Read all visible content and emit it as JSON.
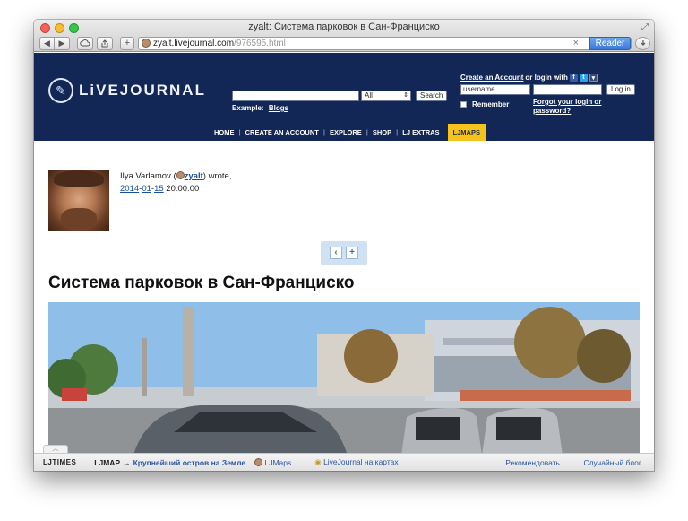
{
  "window": {
    "title": "zyalt: Система парковок в Сан-Франциско"
  },
  "toolbar": {
    "url_host": "zyalt.livejournal.com",
    "url_path": "/976595.html",
    "reader_label": "Reader",
    "clear_icon": "×"
  },
  "header": {
    "logo_text": "LiVEJOURNAL",
    "search": {
      "select_value": "All",
      "button_label": "Search",
      "example_label": "Example:",
      "example_link": "Blogs"
    },
    "login": {
      "create_account": "Create an Account",
      "or_login_with": "or login with",
      "username_value": "username",
      "login_button": "Log in",
      "remember": "Remember",
      "forgot": "Forgot your login or password?"
    },
    "nav": [
      {
        "label": "HOME"
      },
      {
        "label": "CREATE AN ACCOUNT"
      },
      {
        "label": "EXPLORE"
      },
      {
        "label": "SHOP"
      },
      {
        "label": "LJ EXTRAS"
      },
      {
        "label": "LJMAPS"
      }
    ]
  },
  "post": {
    "author_name": "Ilya Varlamov (",
    "username": "zyalt",
    "wrote": ") wrote,",
    "date_year": "2014",
    "date_month": "01",
    "date_day": "15",
    "time": "20:00:00",
    "title": "Система парковок в Сан-Франциско"
  },
  "bottombar": {
    "lj_times": "LJTIMES",
    "ljmap_label": "LJMAP",
    "arrow": "→",
    "ljmap_link": "Крупнейший остров на Земле",
    "ljmaps_link": "LJMaps",
    "onmap": "LiveJournal на картах",
    "recommend": "Рекомендовать",
    "random_blog": "Случайный блог"
  },
  "colors": {
    "header_bg": "#122755",
    "active_tab": "#f6c21c",
    "link": "#1c4ea0",
    "reader_btn": "#3a78d8"
  }
}
